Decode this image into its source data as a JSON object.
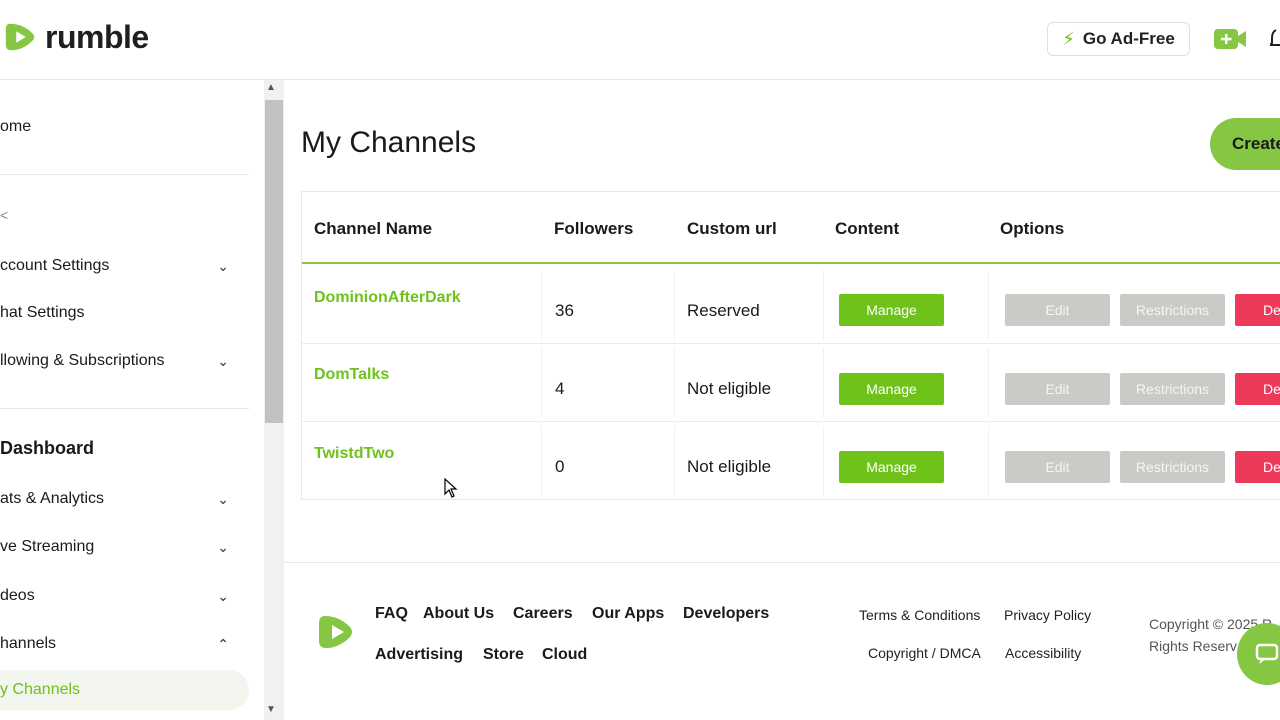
{
  "header": {
    "logo_text": "rumble",
    "go_ad_free": "Go Ad-Free",
    "brand_color": "#6ec21a"
  },
  "sidebar": {
    "items": [
      {
        "label": "ome"
      },
      {
        "label": "ccount Settings",
        "chevron": "⌄"
      },
      {
        "label": "hat Settings"
      },
      {
        "label": "llowing & Subscriptions",
        "chevron": "⌄"
      },
      {
        "label": "Dashboard"
      },
      {
        "label": "ats & Analytics",
        "chevron": "⌄"
      },
      {
        "label": "ve Streaming",
        "chevron": "⌄"
      },
      {
        "label": "deos",
        "chevron": "⌄"
      },
      {
        "label": "hannels",
        "chevron": "⌃"
      },
      {
        "label": "y Channels"
      }
    ],
    "stray_glyph": "<"
  },
  "main": {
    "title": "My Channels",
    "create_label": "Create"
  },
  "table": {
    "headers": [
      "Channel Name",
      "Followers",
      "Custom url",
      "Content",
      "Options"
    ],
    "rows": [
      {
        "name": "DominionAfterDark",
        "followers": "36",
        "custom_url": "Reserved",
        "manage": "Manage",
        "edit": "Edit",
        "restrictions": "Restrictions",
        "delete": "De"
      },
      {
        "name": "DomTalks",
        "followers": "4",
        "custom_url": "Not eligible",
        "manage": "Manage",
        "edit": "Edit",
        "restrictions": "Restrictions",
        "delete": "De"
      },
      {
        "name": "TwistdTwo",
        "followers": "0",
        "custom_url": "Not eligible",
        "manage": "Manage",
        "edit": "Edit",
        "restrictions": "Restrictions",
        "delete": "De"
      }
    ]
  },
  "footer": {
    "links_row1": [
      "FAQ",
      "About Us",
      "Careers",
      "Our Apps",
      "Developers"
    ],
    "links_row2": [
      "Advertising",
      "Store",
      "Cloud"
    ],
    "legal": [
      "Terms & Conditions",
      "Privacy Policy",
      "Copyright / DMCA",
      "Accessibility"
    ],
    "copyright_1": "Copyright © 2025 R",
    "copyright_2": "Rights Reserv"
  }
}
